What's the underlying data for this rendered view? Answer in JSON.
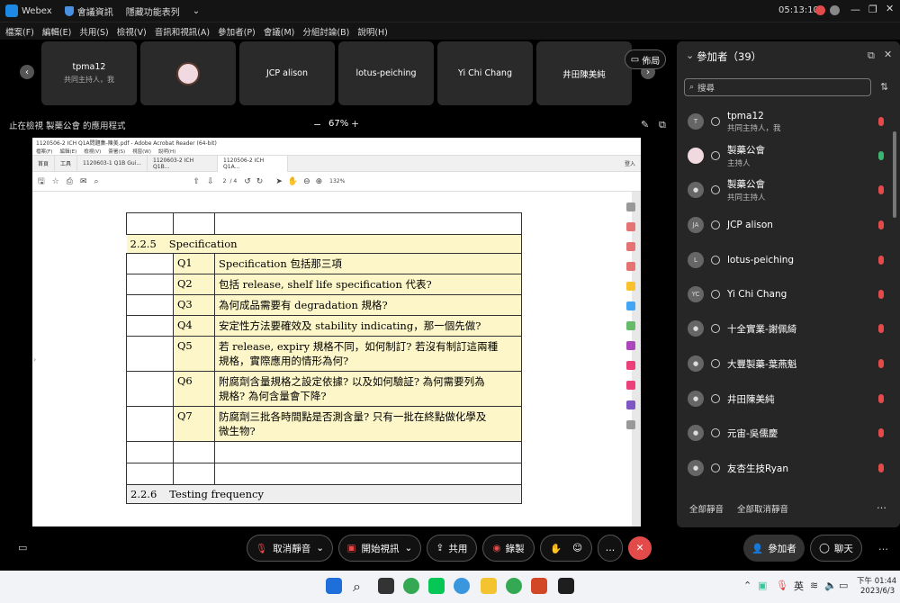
{
  "app": {
    "title": "Webex",
    "tabs": [
      "會議資訊",
      "隱藏功能表列"
    ],
    "clock": "05:13:10"
  },
  "menu": [
    "檔案(F)",
    "編輯(E)",
    "共用(S)",
    "檢視(V)",
    "音訊和視訊(A)",
    "參加者(P)",
    "會議(M)",
    "分組討論(B)",
    "說明(H)"
  ],
  "tiles": [
    {
      "name": "tpma12",
      "sub": "共同主持人，我"
    },
    {
      "name": "",
      "sub": ""
    },
    {
      "name": "JCP alison",
      "sub": ""
    },
    {
      "name": "lotus-peiching",
      "sub": ""
    },
    {
      "name": "Yi Chi Chang",
      "sub": ""
    },
    {
      "name": "井田陳美純",
      "sub": ""
    }
  ],
  "layout_button": "佈局",
  "share": {
    "status": "止在檢視 製藥公會 的應用程式",
    "zoom": "67%"
  },
  "acrobat": {
    "title": "1120506-2 ICH Q1A問題集-陳美.pdf - Adobe Acrobat Reader (64-bit)",
    "menu": [
      "檔案(F)",
      "編輯(E)",
      "檢視(V)",
      "簽署(S)",
      "視窗(W)",
      "說明(H)"
    ],
    "tabs": [
      "首頁",
      "工具",
      "1120603-1 Q1B Gui...",
      "1120603-2 ICH Q1B...",
      "1120506-2 ICH Q1A..."
    ],
    "page": "2",
    "pages": "/ 4",
    "zoom": "132%",
    "signin": "登入"
  },
  "doc": {
    "section": "2.2.5",
    "section_title": "Specification",
    "rows": [
      {
        "q": "Q1",
        "t1": "Specification",
        "t2": "包括那三項"
      },
      {
        "q": "Q2",
        "t1": "包括 release, shelf life specification",
        "t2": "代表?"
      },
      {
        "q": "Q3",
        "t1": "為何成品需要有 degradation",
        "t2": "規格?"
      },
      {
        "q": "Q4",
        "t1": "安定性方法要確效及 stability indicating，那一個先做?",
        "t2": ""
      },
      {
        "q": "Q5",
        "t1": "若 release, expiry 規格不同，如何制訂? 若沒有制訂這兩種",
        "t2": "規格，實際應用的情形為何?"
      },
      {
        "q": "Q6",
        "t1": "附腐劑含量規格之設定依據? 以及如何驗証? 為何需要列為",
        "t2": "規格? 為何含量會下降?"
      },
      {
        "q": "Q7",
        "t1": "防腐劑三批各時間點是否測含量? 只有一批在終點做化學及",
        "t2": "微生物?"
      }
    ],
    "section2": "2.2.6",
    "section2_title": "Testing frequency"
  },
  "panel": {
    "title": "參加者（39）",
    "search_placeholder": "搜尋",
    "mute_all": "全部靜音",
    "unmute_all": "全部取消靜音",
    "people": [
      {
        "avatar": "T",
        "name": "tpma12",
        "sub": "共同主持人，我",
        "mic": "#e34b4b"
      },
      {
        "avatar": "",
        "name": "製藥公會",
        "sub": "主持人",
        "mic": "#3cb371"
      },
      {
        "avatar": "",
        "name": "製藥公會",
        "sub": "共同主持人",
        "mic": "#e34b4b"
      },
      {
        "avatar": "JA",
        "name": "JCP alison",
        "sub": "",
        "mic": "#e34b4b"
      },
      {
        "avatar": "L",
        "name": "lotus-peiching",
        "sub": "",
        "mic": "#e34b4b"
      },
      {
        "avatar": "YC",
        "name": "Yi Chi Chang",
        "sub": "",
        "mic": "#e34b4b"
      },
      {
        "avatar": "",
        "name": "十全實業-謝佩綺",
        "sub": "",
        "mic": "#e34b4b"
      },
      {
        "avatar": "",
        "name": "大豐製藥-葉燕魁",
        "sub": "",
        "mic": "#e34b4b"
      },
      {
        "avatar": "",
        "name": "井田陳美純",
        "sub": "",
        "mic": "#e34b4b"
      },
      {
        "avatar": "",
        "name": "元宙-吳儒慶",
        "sub": "",
        "mic": "#e34b4b"
      },
      {
        "avatar": "",
        "name": "友杏生技Ryan",
        "sub": "",
        "mic": "#e34b4b"
      }
    ]
  },
  "controls": {
    "mute": "取消靜音",
    "video": "開始視訊",
    "share": "共用",
    "record": "錄製",
    "participants": "參加者",
    "chat": "聊天"
  },
  "taskbar": {
    "ime": "英",
    "time": "下午 01:44",
    "date": "2023/6/3"
  }
}
